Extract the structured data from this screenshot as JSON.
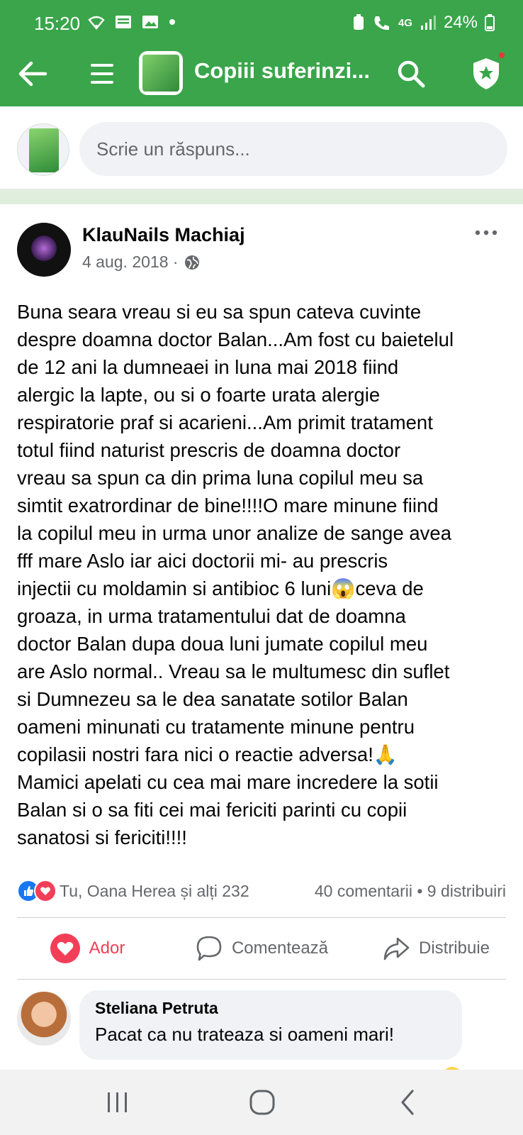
{
  "status_bar": {
    "time": "15:20",
    "network": "4G",
    "battery": "24%"
  },
  "app_bar": {
    "title": "Copiii suferinzi..."
  },
  "composer": {
    "placeholder": "Scrie un răspuns..."
  },
  "post": {
    "author": "KlauNails Machiaj",
    "date": "4 aug. 2018 ·",
    "lines": [
      "Buna seara vreau si eu sa spun cateva cuvinte",
      "despre doamna doctor Balan...Am fost cu baietelul",
      "de 12 ani la dumneaei in luna mai 2018 fiind",
      "alergic la lapte, ou si o foarte urata alergie",
      "respiratorie praf si acarieni...Am primit tratament",
      "totul fiind naturist prescris de doamna doctor",
      "vreau sa spun ca din prima luna copilul meu sa",
      "simtit exatrordinar de bine!!!!O mare minune fiind",
      "la copilul meu in urma unor analize de sange avea",
      "fff mare Aslo iar aici doctorii mi- au prescris",
      "injectii cu moldamin si antibioc 6 luni😱ceva de",
      "groaza, in urma tratamentului dat de doamna",
      "doctor Balan dupa doua luni jumate copilul meu",
      "are Aslo normal.. Vreau sa le multumesc din suflet",
      "si Dumnezeu sa le dea sanatate sotilor Balan",
      "oameni minunati cu tratamente minune pentru",
      "copilasii nostri fara nici o reactie adversa!🙏",
      "Mamici apelati cu cea mai mare incredere la sotii",
      "Balan si o sa fiti cei mai fericiti parinti cu copii",
      "sanatosi si fericiti!!!!"
    ],
    "reactions_text": "Tu, Oana Herea și alți 232",
    "stats_text": "40 comentarii • 9 distribuiri"
  },
  "actions": {
    "love_label": "Ador",
    "comment_label": "Comentează",
    "share_label": "Distribuie"
  },
  "comment": {
    "name": "Steliana Petruta",
    "text": "Pacat ca nu trateaza si oameni mari!"
  },
  "colors": {
    "brand_green": "#3aa54a",
    "love": "#f33e58",
    "like": "#1877f2"
  },
  "icons": [
    "back-arrow-icon",
    "menu-icon",
    "search-icon",
    "shield-star-icon",
    "globe-icon",
    "more-icon",
    "heart-icon",
    "comment-icon",
    "share-icon",
    "recents-icon",
    "home-icon",
    "back-icon"
  ]
}
